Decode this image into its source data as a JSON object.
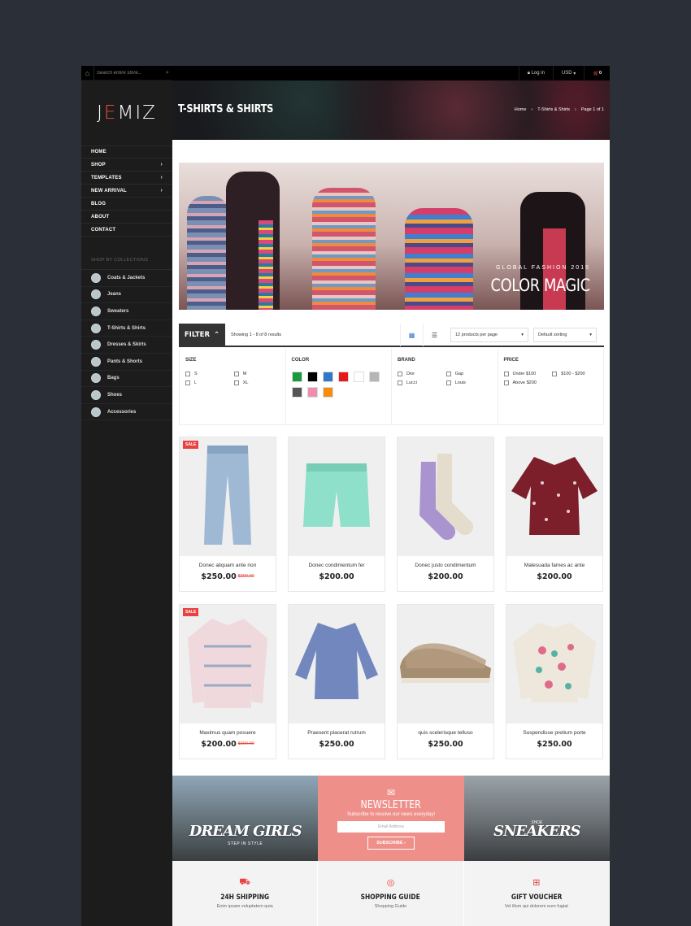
{
  "search": {
    "placeholder": "Search entire store..."
  },
  "brand": {
    "logo_pre": "J",
    "logo_e": "E",
    "logo_post": "MIZ"
  },
  "topbar": {
    "login": "Log in",
    "currency": "USD",
    "cart_count": "0"
  },
  "header": {
    "title": "T-SHIRTS & SHIRTS",
    "crumbs": [
      "Home",
      "T-Shirts & Shirts",
      "Page 1 of 1"
    ]
  },
  "menu": [
    {
      "label": "HOME",
      "sub": false
    },
    {
      "label": "SHOP",
      "sub": true
    },
    {
      "label": "TEMPLATES",
      "sub": true
    },
    {
      "label": "NEW ARRIVAL",
      "sub": true
    },
    {
      "label": "BLOG",
      "sub": false
    },
    {
      "label": "ABOUT",
      "sub": false
    },
    {
      "label": "CONTACT",
      "sub": false
    }
  ],
  "collections": {
    "title": "SHOP BY COLLECTIONS",
    "items": [
      "Coats & Jackets",
      "Jeans",
      "Sweaters",
      "T-Shirts & Shirts",
      "Dresses & Skirts",
      "Pants & Shorts",
      "Bags",
      "Shoes",
      "Accessories"
    ]
  },
  "banner": {
    "tag": "GLOBAL FASHION 2015",
    "headline": "COLOR MAGIC"
  },
  "toolbar": {
    "filter": "FILTER",
    "showing": "Showing 1 - 8 of 8 results",
    "per_page": "12 products per page",
    "sort": "Default sorting"
  },
  "filters": {
    "size": {
      "title": "SIZE",
      "options": [
        "S",
        "M",
        "L",
        "XL"
      ]
    },
    "color": {
      "title": "COLOR",
      "swatches": [
        "#1a9a3a",
        "#000000",
        "#2f77c9",
        "#e81818",
        "#ffffff",
        "#b5b5b5",
        "#555555",
        "#ee8db0",
        "#f58b12"
      ]
    },
    "brand": {
      "title": "BRAND",
      "options": [
        "Dior",
        "Gap",
        "Lucci",
        "Louis"
      ]
    },
    "price": {
      "title": "PRICE",
      "options": [
        "Under $100",
        "$100 - $200",
        "Above $200"
      ]
    }
  },
  "products": [
    {
      "name": "Donec aliquam ante non",
      "price": "$250.00",
      "old": "$300.00",
      "sale": "SALE",
      "img": "jeans"
    },
    {
      "name": "Donec condimentum fer",
      "price": "$200.00",
      "old": "",
      "sale": "",
      "img": "shorts"
    },
    {
      "name": "Donec justo condimentum",
      "price": "$200.00",
      "old": "",
      "sale": "",
      "img": "socks"
    },
    {
      "name": "Malesuada fames ac ante",
      "price": "$200.00",
      "old": "",
      "sale": "",
      "img": "blouse"
    },
    {
      "name": "Maximus quam posuere",
      "price": "$200.00",
      "old": "$300.00",
      "sale": "SALE",
      "img": "shirt"
    },
    {
      "name": "Praesent placerat rutrum",
      "price": "$250.00",
      "old": "",
      "sale": "",
      "img": "top"
    },
    {
      "name": "quis scelerisque telluso",
      "price": "$250.00",
      "old": "",
      "sale": "",
      "img": "shoes"
    },
    {
      "name": "Suspendisse pretium porte",
      "price": "$250.00",
      "old": "",
      "sale": "",
      "img": "sweater"
    }
  ],
  "promo": {
    "left": {
      "title": "DREAM GIRLS",
      "sub": "STEP IN STYLE"
    },
    "newsletter": {
      "title": "NEWSLETTER",
      "text": "Subscribe to receive our news everyday!",
      "placeholder": "Email Address",
      "button": "SUBSCRIBE"
    },
    "right": {
      "small": "SHOE",
      "title": "SNEAKERS"
    }
  },
  "features": [
    {
      "icon": "truck-icon",
      "title": "24H SHIPPING",
      "text": "Enim ipsam voluptatem quia"
    },
    {
      "icon": "lifebuoy-icon",
      "title": "SHOPPING GUIDE",
      "text": "Shopping Guide"
    },
    {
      "icon": "gift-icon",
      "title": "GIFT VOUCHER",
      "text": "Vel illum qui dolorem eum fugiat"
    }
  ]
}
